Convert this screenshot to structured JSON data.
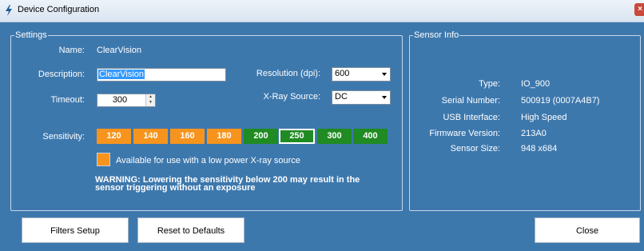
{
  "window": {
    "title": "Device Configuration",
    "close_glyph": "×"
  },
  "settings": {
    "legend": "Settings",
    "name_label": "Name:",
    "name_value": "ClearVision",
    "description_label": "Description:",
    "description_value": "ClearVision",
    "timeout_label": "Timeout:",
    "timeout_value": "300",
    "resolution_label": "Resolution (dpi):",
    "resolution_value": "600",
    "xray_label": "X-Ray Source:",
    "xray_value": "DC",
    "sensitivity_label": "Sensitivity:",
    "sensitivity": [
      {
        "label": "120",
        "color": "orange"
      },
      {
        "label": "140",
        "color": "orange"
      },
      {
        "label": "160",
        "color": "orange"
      },
      {
        "label": "180",
        "color": "orange"
      },
      {
        "label": "200",
        "color": "green"
      },
      {
        "label": "250",
        "color": "green",
        "selected": true
      },
      {
        "label": "300",
        "color": "green"
      },
      {
        "label": "400",
        "color": "green"
      }
    ],
    "legend_note": "Available for use with a low power X-ray source",
    "warning": "WARNING: Lowering the sensitivity below 200 may result in the sensor triggering without an exposure"
  },
  "sensor_info": {
    "legend": "Sensor Info",
    "rows": [
      {
        "label": "Type:",
        "value": "IO_900"
      },
      {
        "label": "Serial Number:",
        "value": "500919 (0007A4B7)"
      },
      {
        "label": "USB Interface:",
        "value": "High Speed"
      },
      {
        "label": "Firmware Version:",
        "value": "213A0"
      },
      {
        "label": "Sensor Size:",
        "value": "948 x684"
      }
    ]
  },
  "buttons": {
    "filters": "Filters Setup",
    "reset": "Reset to Defaults",
    "close": "Close"
  },
  "colors": {
    "background": "#3d78ad",
    "orange": "#f7941d",
    "green": "#1f8b22",
    "selection": "#3399ff"
  }
}
